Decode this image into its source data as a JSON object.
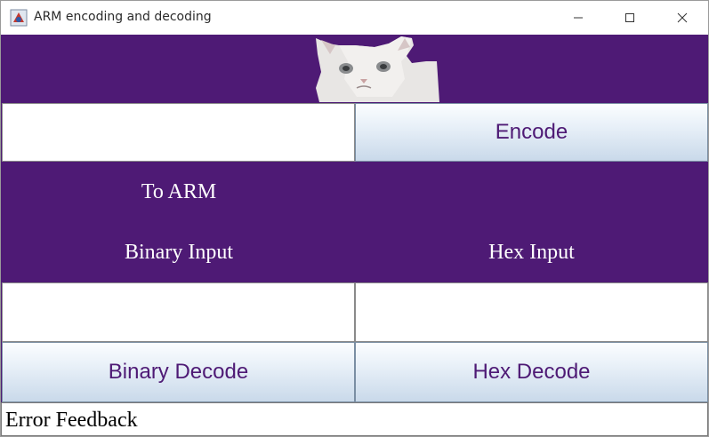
{
  "window": {
    "title": "ARM encoding and decoding",
    "icons": [
      "java-app-icon",
      "minimize-icon",
      "maximize-icon",
      "close-icon"
    ]
  },
  "banner": {
    "image": "crying-cat-image",
    "background": "#4e1a75"
  },
  "encode": {
    "input_value": "",
    "button_label": "Encode"
  },
  "labels": {
    "to_arm": "To ARM",
    "binary_input": "Binary Input",
    "hex_input": "Hex Input"
  },
  "decode": {
    "binary_value": "",
    "hex_value": "",
    "binary_button": "Binary Decode",
    "hex_button": "Hex Decode"
  },
  "feedback": {
    "text": "Error Feedback"
  },
  "colors": {
    "purple": "#4e1a75",
    "button_text": "#4e1a75",
    "label_text": "#ffffff"
  }
}
